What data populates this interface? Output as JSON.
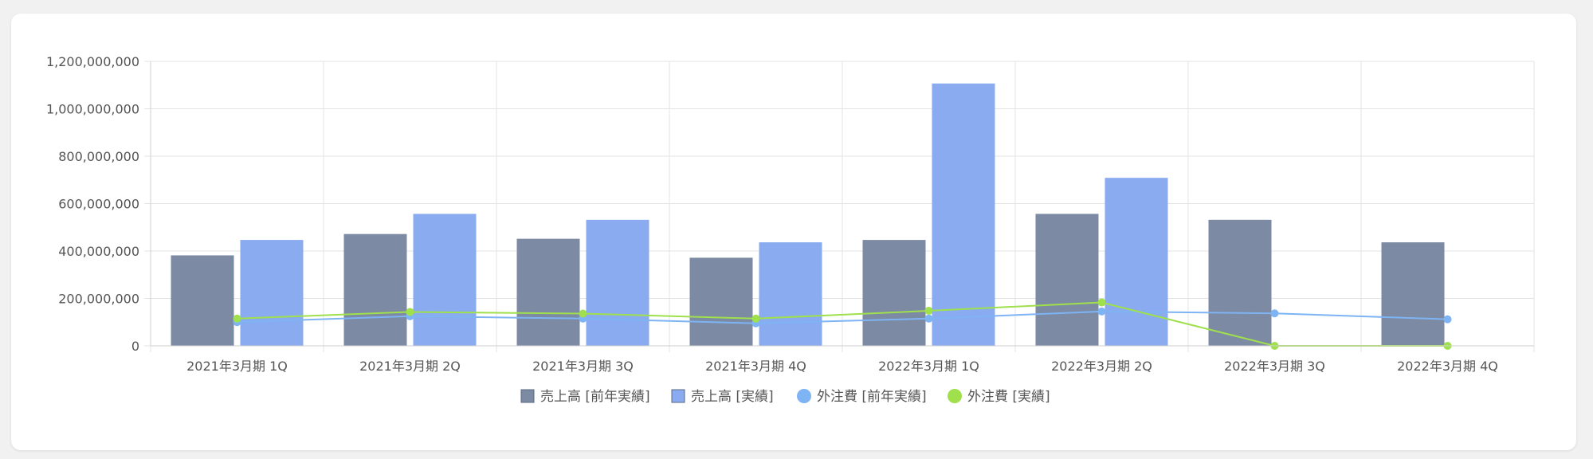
{
  "chart_data": {
    "type": "bar",
    "categories": [
      "2021年3月期 1Q",
      "2021年3月期 2Q",
      "2021年3月期 3Q",
      "2021年3月期 4Q",
      "2022年3月期 1Q",
      "2022年3月期 2Q",
      "2022年3月期 3Q",
      "2022年3月期 4Q"
    ],
    "ylim": [
      0,
      1200000000
    ],
    "yticks": [
      0,
      200000000,
      400000000,
      600000000,
      800000000,
      1000000000,
      1200000000
    ],
    "ytick_labels": [
      "0",
      "200,000,000",
      "400,000,000",
      "600,000,000",
      "800,000,000",
      "1,000,000,000",
      "1,200,000,000"
    ],
    "grid": true,
    "legend_position": "bottom",
    "series": [
      {
        "name": "売上高 [前年実績]",
        "type": "bar",
        "color": "#7c8aa3",
        "values": [
          380000000,
          470000000,
          450000000,
          370000000,
          445000000,
          555000000,
          530000000,
          435000000
        ]
      },
      {
        "name": "売上高 [実績]",
        "type": "bar",
        "color": "#8aabef",
        "values": [
          445000000,
          555000000,
          530000000,
          435000000,
          1105000000,
          707000000,
          null,
          null
        ]
      },
      {
        "name": "外注費 [前年実績]",
        "type": "line",
        "color": "#7eb4f3",
        "values": [
          100000000,
          125000000,
          115000000,
          95000000,
          115000000,
          145000000,
          137000000,
          112000000
        ]
      },
      {
        "name": "外注費 [実績]",
        "type": "line",
        "color": "#9fe04c",
        "values": [
          115000000,
          143000000,
          136000000,
          115000000,
          148000000,
          183000000,
          0,
          0
        ]
      }
    ]
  }
}
